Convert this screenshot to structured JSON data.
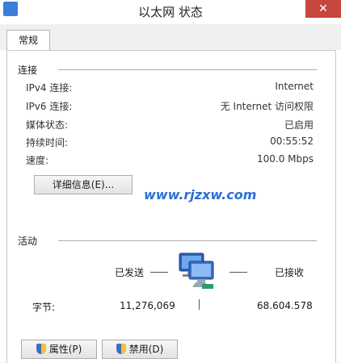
{
  "window": {
    "title": "以太网 状态",
    "close_glyph": "✕"
  },
  "tabs": [
    {
      "label": "常规"
    }
  ],
  "connection": {
    "section_title": "连接",
    "rows": [
      {
        "label": "IPv4 连接:",
        "value": "Internet"
      },
      {
        "label": "IPv6 连接:",
        "value": "无 Internet 访问权限"
      },
      {
        "label": "媒体状态:",
        "value": "已启用"
      },
      {
        "label": "持续时间:",
        "value": "00:55:52"
      },
      {
        "label": "速度:",
        "value": "100.0 Mbps"
      }
    ],
    "details_button": "详细信息(E)..."
  },
  "watermark": "www.rjzxw.com",
  "activity": {
    "section_title": "活动",
    "sent_label": "已发送",
    "received_label": "已接收",
    "bytes_label": "字节:",
    "bytes_sent": "11,276,069",
    "bytes_received": "68.604.578",
    "network_icon": "computer-network-icon"
  },
  "buttons": {
    "properties": "属性(P)",
    "disable": "禁用(D)"
  }
}
